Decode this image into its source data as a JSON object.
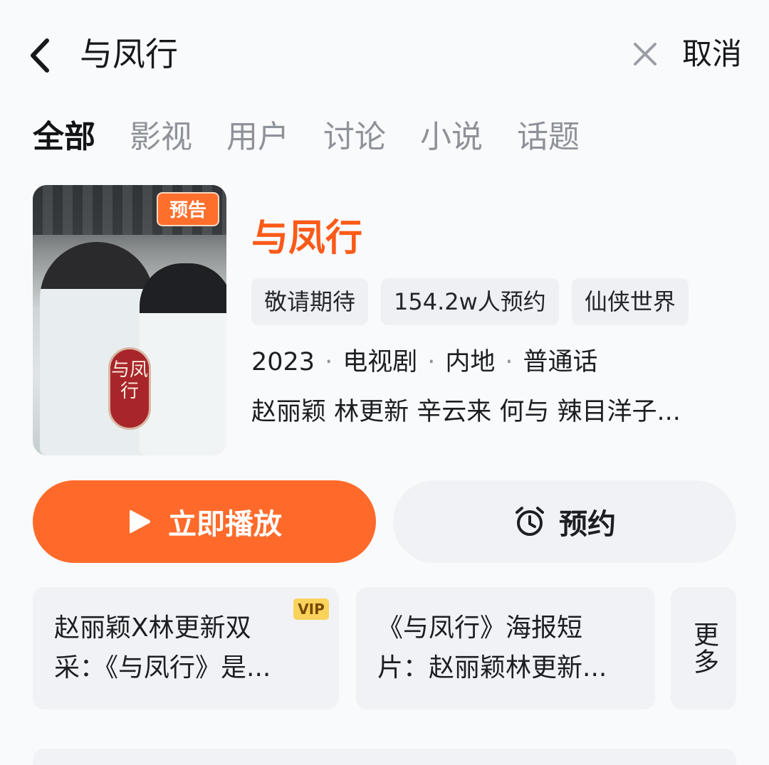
{
  "search": {
    "query": "与凤行",
    "cancel_label": "取消",
    "back_icon": "chevron-left-icon",
    "clear_icon": "close-icon"
  },
  "tabs": [
    {
      "label": "全部",
      "active": true
    },
    {
      "label": "影视",
      "active": false
    },
    {
      "label": "用户",
      "active": false
    },
    {
      "label": "讨论",
      "active": false
    },
    {
      "label": "小说",
      "active": false
    },
    {
      "label": "话题",
      "active": false
    }
  ],
  "result": {
    "badge": "预告",
    "poster_seal_text": "与凤行",
    "title": "与凤行",
    "chips": [
      "敬请期待",
      "154.2w人预约",
      "仙侠世界"
    ],
    "meta": {
      "year": "2023",
      "type": "电视剧",
      "region": "内地",
      "language": "普通话"
    },
    "cast": "赵丽颖 林更新 辛云来 何与 辣目洋子..."
  },
  "actions": {
    "play_label": "立即播放",
    "reserve_label": "预约"
  },
  "related": {
    "items": [
      {
        "line1": "赵丽颖X林更新双",
        "line2": "采：《与凤行》是...",
        "vip": "VIP"
      },
      {
        "line1": "《与凤行》海报短",
        "line2": "片：赵丽颖林更新..."
      }
    ],
    "more_label": "更多"
  },
  "colors": {
    "accent": "#ff6a2a",
    "title": "#fb5a18",
    "chip_bg": "#eef0f3",
    "inactive_tab": "#8e9299"
  }
}
